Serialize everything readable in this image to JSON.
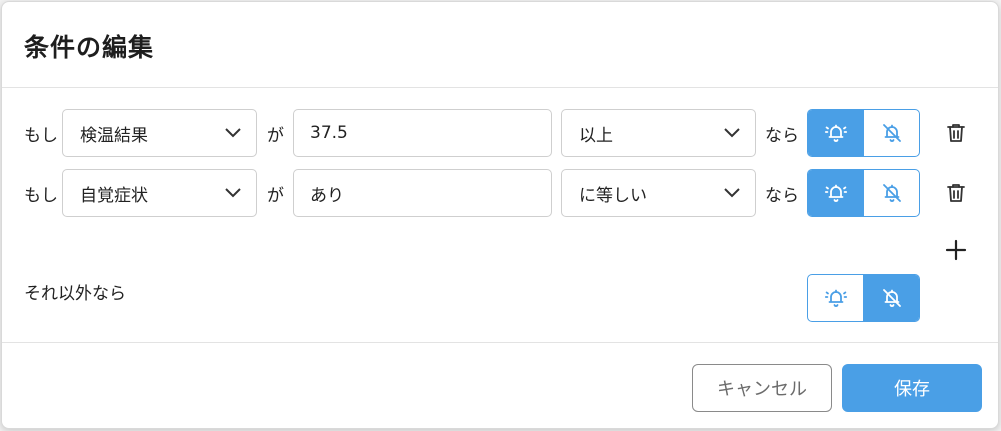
{
  "dialog": {
    "title": "条件の編集"
  },
  "conditions": [
    {
      "prefix": "もし",
      "field": "検温結果",
      "connector": "が",
      "value": "37.5",
      "operator": "以上",
      "suffix": "なら",
      "alert_on": true
    },
    {
      "prefix": "もし",
      "field": "自覚症状",
      "connector": "が",
      "value": "あり",
      "operator": "に等しい",
      "suffix": "なら",
      "alert_on": true
    }
  ],
  "else_label": "それ以外なら",
  "else_alert_on": false,
  "buttons": {
    "cancel": "キャンセル",
    "save": "保存"
  },
  "colors": {
    "accent": "#4a9fe6"
  },
  "icons": {
    "dropdown": "chevron-down-icon",
    "alert_on": "bell-ringing-icon",
    "alert_off": "bell-off-icon",
    "delete": "trash-icon",
    "add": "plus-icon"
  }
}
